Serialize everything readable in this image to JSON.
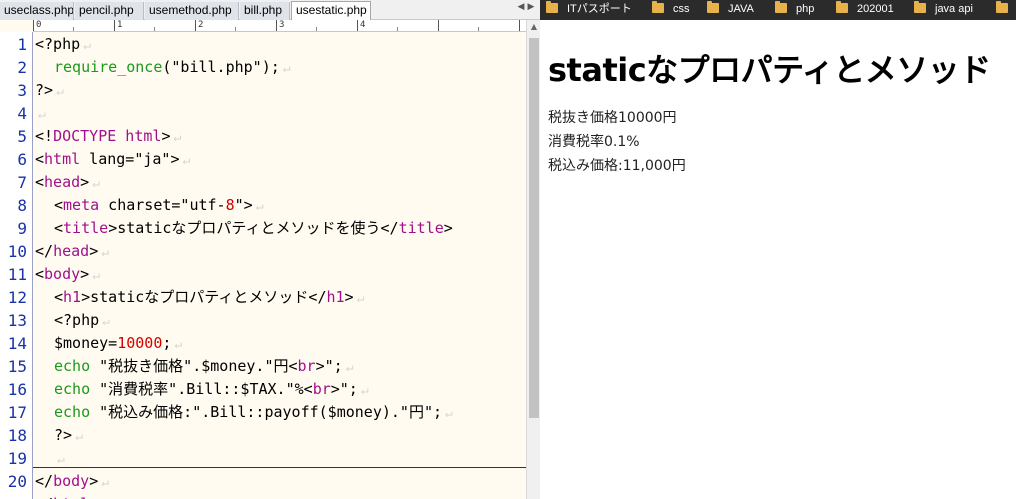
{
  "editor": {
    "tabs": [
      {
        "label": "useclass.php",
        "active": false
      },
      {
        "label": "pencil.php",
        "active": false
      },
      {
        "label": "usemethod.php",
        "active": false
      },
      {
        "label": "bill.php",
        "active": false
      },
      {
        "label": "usestatic.php",
        "active": true
      }
    ],
    "ruler": [
      "0",
      "1",
      "2",
      "3",
      "4"
    ],
    "line_numbers": [
      "1",
      "2",
      "3",
      "4",
      "5",
      "6",
      "7",
      "8",
      "9",
      "10",
      "11",
      "12",
      "13",
      "14",
      "15",
      "16",
      "17",
      "18",
      "19",
      "20"
    ],
    "code": {
      "l1": {
        "open": "<?php"
      },
      "l2": {
        "func": "require_once",
        "rest": "(\"bill.php\");"
      },
      "l3": {
        "close": "?>"
      },
      "l5": {
        "a": "<!",
        "tn": "DOCTYPE html",
        "b": ">"
      },
      "l6": {
        "a": "<",
        "tn": "html",
        "b": " lang=\"ja\">"
      },
      "l7": {
        "a": "<",
        "tn": "head",
        "b": ">"
      },
      "l8": {
        "a": "<",
        "tn": "meta",
        "b": " charset=\"utf-",
        "num": "8",
        "c": "\">"
      },
      "l9": {
        "a": "<",
        "tn": "title",
        "b": ">staticなプロパティとメソッドを使う</",
        "tn2": "title",
        "c": ">"
      },
      "l10": {
        "a": "</",
        "tn": "head",
        "b": ">"
      },
      "l11": {
        "a": "<",
        "tn": "body",
        "b": ">"
      },
      "l12": {
        "a": "<",
        "tn": "h1",
        "b": ">staticなプロパティとメソッド</",
        "tn2": "h1",
        "c": ">"
      },
      "l13": {
        "text": "<?php"
      },
      "l14": {
        "a": "$money=",
        "num": "10000",
        "b": ";"
      },
      "l15": {
        "kw": "echo",
        "a": " \"税抜き価格\".$money.\"円<",
        "tn": "br",
        "b": ">\";"
      },
      "l16": {
        "kw": "echo",
        "a": " \"消費税率\".Bill::$TAX.\"%<",
        "tn": "br",
        "b": ">\";"
      },
      "l17": {
        "kw": "echo",
        "a": " \"税込み価格:\".Bill::payoff($money).\"円\";"
      },
      "l18": {
        "text": "?>"
      },
      "l20": {
        "a": "</",
        "tn": "body",
        "b": ">"
      },
      "l21": {
        "a": "</",
        "tn": "html",
        "b": ">"
      }
    },
    "eol_mark": "↵"
  },
  "browser": {
    "bookmarks": [
      "ITパスポート",
      "css",
      "JAVA",
      "php",
      "202001",
      "java api"
    ],
    "page": {
      "heading": "staticなプロパティとメソッド",
      "lines": [
        "税抜き価格10000円",
        "消費税率0.1%",
        "税込み価格:11,000円"
      ]
    }
  },
  "colors": {
    "tag_name": "#a0108c",
    "keyword": "#1a9a1a",
    "number": "#d40000",
    "line_number": "#1a32a8",
    "editor_bg": "#fffbf0",
    "bookmark_bar": "#2b2b2b",
    "folder": "#e8b24a"
  }
}
